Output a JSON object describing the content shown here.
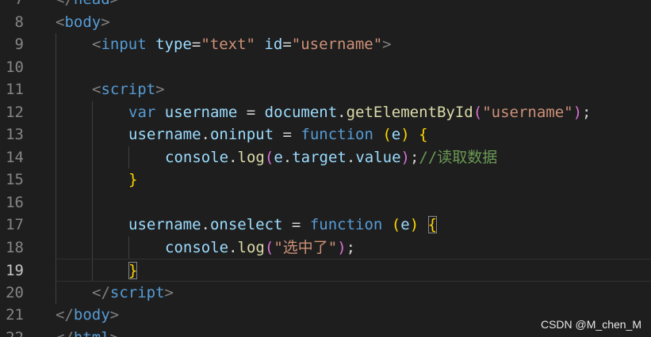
{
  "editor": {
    "active_line": 19,
    "lines": [
      {
        "number": "7",
        "indent": 0,
        "tokens": [
          {
            "t": "</",
            "c": "punct"
          },
          {
            "t": "head",
            "c": "tag"
          },
          {
            "t": ">",
            "c": "punct"
          }
        ]
      },
      {
        "number": "8",
        "indent": 0,
        "tokens": [
          {
            "t": "<",
            "c": "punct"
          },
          {
            "t": "body",
            "c": "tag"
          },
          {
            "t": ">",
            "c": "punct"
          }
        ]
      },
      {
        "number": "9",
        "indent": 1,
        "tokens": [
          {
            "t": "<",
            "c": "punct"
          },
          {
            "t": "input",
            "c": "tag"
          },
          {
            "t": " ",
            "c": "plain"
          },
          {
            "t": "type",
            "c": "attr"
          },
          {
            "t": "=",
            "c": "plain"
          },
          {
            "t": "\"text\"",
            "c": "str"
          },
          {
            "t": " ",
            "c": "plain"
          },
          {
            "t": "id",
            "c": "attr"
          },
          {
            "t": "=",
            "c": "plain"
          },
          {
            "t": "\"username\"",
            "c": "str"
          },
          {
            "t": ">",
            "c": "punct"
          }
        ]
      },
      {
        "number": "10",
        "indent": 0,
        "tokens": []
      },
      {
        "number": "11",
        "indent": 1,
        "tokens": [
          {
            "t": "<",
            "c": "punct"
          },
          {
            "t": "script",
            "c": "tag"
          },
          {
            "t": ">",
            "c": "punct"
          }
        ]
      },
      {
        "number": "12",
        "indent": 2,
        "tokens": [
          {
            "t": "var",
            "c": "kw"
          },
          {
            "t": " ",
            "c": "plain"
          },
          {
            "t": "username",
            "c": "var"
          },
          {
            "t": " = ",
            "c": "plain"
          },
          {
            "t": "document",
            "c": "var"
          },
          {
            "t": ".",
            "c": "plain"
          },
          {
            "t": "getElementById",
            "c": "fn"
          },
          {
            "t": "(",
            "c": "b2"
          },
          {
            "t": "\"username\"",
            "c": "str"
          },
          {
            "t": ")",
            "c": "b2"
          },
          {
            "t": ";",
            "c": "plain"
          }
        ]
      },
      {
        "number": "13",
        "indent": 2,
        "tokens": [
          {
            "t": "username",
            "c": "var"
          },
          {
            "t": ".",
            "c": "plain"
          },
          {
            "t": "oninput",
            "c": "var"
          },
          {
            "t": " = ",
            "c": "plain"
          },
          {
            "t": "function",
            "c": "kw"
          },
          {
            "t": " ",
            "c": "plain"
          },
          {
            "t": "(",
            "c": "b1"
          },
          {
            "t": "e",
            "c": "var"
          },
          {
            "t": ")",
            "c": "b1"
          },
          {
            "t": " ",
            "c": "plain"
          },
          {
            "t": "{",
            "c": "b1"
          }
        ]
      },
      {
        "number": "14",
        "indent": 3,
        "tokens": [
          {
            "t": "console",
            "c": "var"
          },
          {
            "t": ".",
            "c": "plain"
          },
          {
            "t": "log",
            "c": "fn"
          },
          {
            "t": "(",
            "c": "b2"
          },
          {
            "t": "e",
            "c": "var"
          },
          {
            "t": ".",
            "c": "plain"
          },
          {
            "t": "target",
            "c": "var"
          },
          {
            "t": ".",
            "c": "plain"
          },
          {
            "t": "value",
            "c": "var"
          },
          {
            "t": ")",
            "c": "b2"
          },
          {
            "t": ";",
            "c": "plain"
          },
          {
            "t": "//读取数据",
            "c": "comment"
          }
        ]
      },
      {
        "number": "15",
        "indent": 2,
        "tokens": [
          {
            "t": "}",
            "c": "b1"
          }
        ]
      },
      {
        "number": "16",
        "indent": 0,
        "tokens": []
      },
      {
        "number": "17",
        "indent": 2,
        "tokens": [
          {
            "t": "username",
            "c": "var"
          },
          {
            "t": ".",
            "c": "plain"
          },
          {
            "t": "onselect",
            "c": "var"
          },
          {
            "t": " = ",
            "c": "plain"
          },
          {
            "t": "function",
            "c": "kw"
          },
          {
            "t": " ",
            "c": "plain"
          },
          {
            "t": "(",
            "c": "b1"
          },
          {
            "t": "e",
            "c": "var"
          },
          {
            "t": ")",
            "c": "b1"
          },
          {
            "t": " ",
            "c": "plain"
          },
          {
            "t": "{",
            "c": "b1",
            "match": true
          }
        ]
      },
      {
        "number": "18",
        "indent": 3,
        "tokens": [
          {
            "t": "console",
            "c": "var"
          },
          {
            "t": ".",
            "c": "plain"
          },
          {
            "t": "log",
            "c": "fn"
          },
          {
            "t": "(",
            "c": "b2"
          },
          {
            "t": "\"选中了\"",
            "c": "str"
          },
          {
            "t": ")",
            "c": "b2"
          },
          {
            "t": ";",
            "c": "plain"
          }
        ]
      },
      {
        "number": "19",
        "indent": 2,
        "tokens": [
          {
            "t": "}",
            "c": "b1",
            "match": true
          }
        ]
      },
      {
        "number": "20",
        "indent": 1,
        "tokens": [
          {
            "t": "</",
            "c": "punct"
          },
          {
            "t": "script",
            "c": "tag"
          },
          {
            "t": ">",
            "c": "punct"
          }
        ]
      },
      {
        "number": "21",
        "indent": 0,
        "tokens": [
          {
            "t": "</",
            "c": "punct"
          },
          {
            "t": "body",
            "c": "tag"
          },
          {
            "t": ">",
            "c": "punct"
          }
        ]
      },
      {
        "number": "22",
        "indent": 0,
        "tokens": [
          {
            "t": "</",
            "c": "punct"
          },
          {
            "t": "html",
            "c": "tag"
          },
          {
            "t": ">",
            "c": "punct"
          }
        ]
      }
    ]
  },
  "watermark": "CSDN @M_chen_M",
  "colors": {
    "background": "#1e1e1e",
    "line_number": "#858585",
    "line_number_active": "#c6c6c6",
    "tag": "#569cd6",
    "attribute": "#9cdcfe",
    "string": "#ce9178",
    "function": "#dcdcaa",
    "bracket_level1": "#ffd700",
    "bracket_level2": "#da70d6",
    "comment": "#6a9955"
  }
}
